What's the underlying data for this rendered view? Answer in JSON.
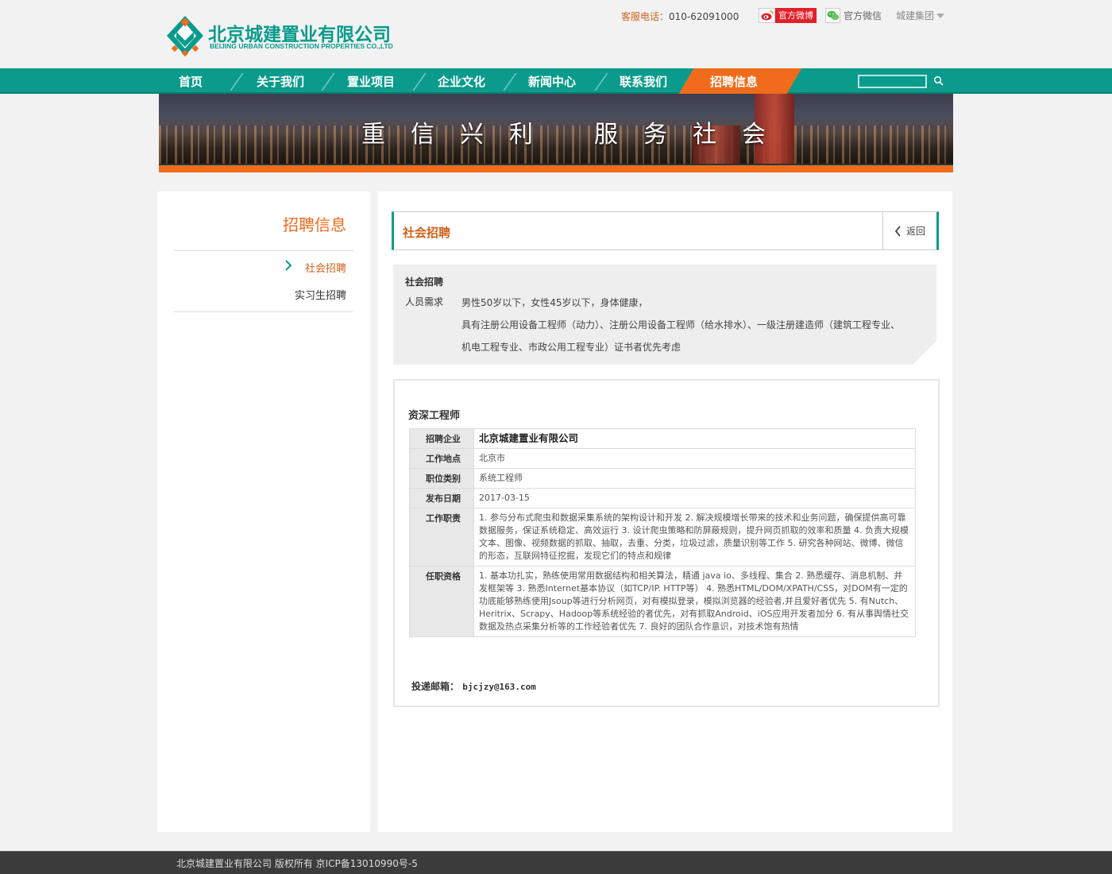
{
  "brand": {
    "name_cn": "北京城建置业有限公司",
    "name_en": "BEIJING URBAN CONSTRUCTION PROPERTIES CO.,LTD",
    "color": "#0a9b8c"
  },
  "topbar": {
    "hotline_label": "客服电话：",
    "hotline_number": "010-62091000",
    "weibo_label": "官方微博",
    "wechat_label": "官方微信",
    "group_label": "城建集团"
  },
  "nav": {
    "items": [
      "首页",
      "关于我们",
      "置业项目",
      "企业文化",
      "新闻中心",
      "联系我们",
      "招聘信息"
    ],
    "active_index": 6,
    "accent_color": "#f06c1c"
  },
  "banner": {
    "slogan_left": "重信兴利",
    "slogan_right": "服务社会"
  },
  "sidebar": {
    "title": "招聘信息",
    "items": [
      {
        "label": "社会招聘",
        "active": true
      },
      {
        "label": "实习生招聘",
        "active": false
      }
    ]
  },
  "section": {
    "title": "社会招聘",
    "back_label": "返回"
  },
  "requirements": {
    "heading": "社会招聘",
    "label": "人员需求",
    "lines": [
      "男性50岁以下，女性45岁以下，身体健康，",
      "具有注册公用设备工程师（动力）、注册公用设备工程师（给水排水）、一级注册建造师（建筑工程专业、",
      "机电工程专业、市政公用工程专业）证书者优先考虑"
    ]
  },
  "job": {
    "title": "资深工程师",
    "rows": [
      {
        "key": "招聘企业",
        "value": "北京城建置业有限公司"
      },
      {
        "key": "工作地点",
        "value": "北京市"
      },
      {
        "key": "职位类别",
        "value": "系统工程师"
      },
      {
        "key": "发布日期",
        "value": "2017-03-15"
      },
      {
        "key": "工作职责",
        "value": "1. 参与分布式爬虫和数据采集系统的架构设计和开发 2. 解决规模增长带来的技术和业务问题，确保提供高可靠数据服务，保证系统稳定、高效运行 3. 设计爬虫策略和防屏蔽规则，提升网页抓取的效率和质量 4. 负责大规模文本、图像、视频数据的抓取、抽取，去重、分类，垃圾过滤，质量识别等工作 5. 研究各种网站、微博、微信的形态，互联网特征挖掘，发现它们的特点和规律"
      },
      {
        "key": "任职资格",
        "value": "1. 基本功扎实，熟练使用常用数据结构和相关算法，精通 java io、多线程、集合 2. 熟悉缓存、消息机制、并发框架等 3. 熟悉Internet基本协议（如TCP/IP. HTTP等） 4. 熟悉HTML/DOM/XPATH/CSS，对DOM有一定的功底能够熟练使用Jsoup等进行分析网页，对有模拟登录，模拟浏览器的经验者,并且爱好者优先 5. 有Nutch、Heritrix、Scrapy、Hadoop等系统经验的者优先，对有抓取Android、iOS应用开发者加分 6. 有从事舆情社交数据及热点采集分析等的工作经验者优先 7. 良好的团队合作意识，对技术饱有热情"
      }
    ],
    "email_label": "投递邮箱：",
    "email": "bjcjzy@163.com"
  },
  "footer": {
    "text": "北京城建置业有限公司 版权所有  京ICP备13010990号-5"
  }
}
